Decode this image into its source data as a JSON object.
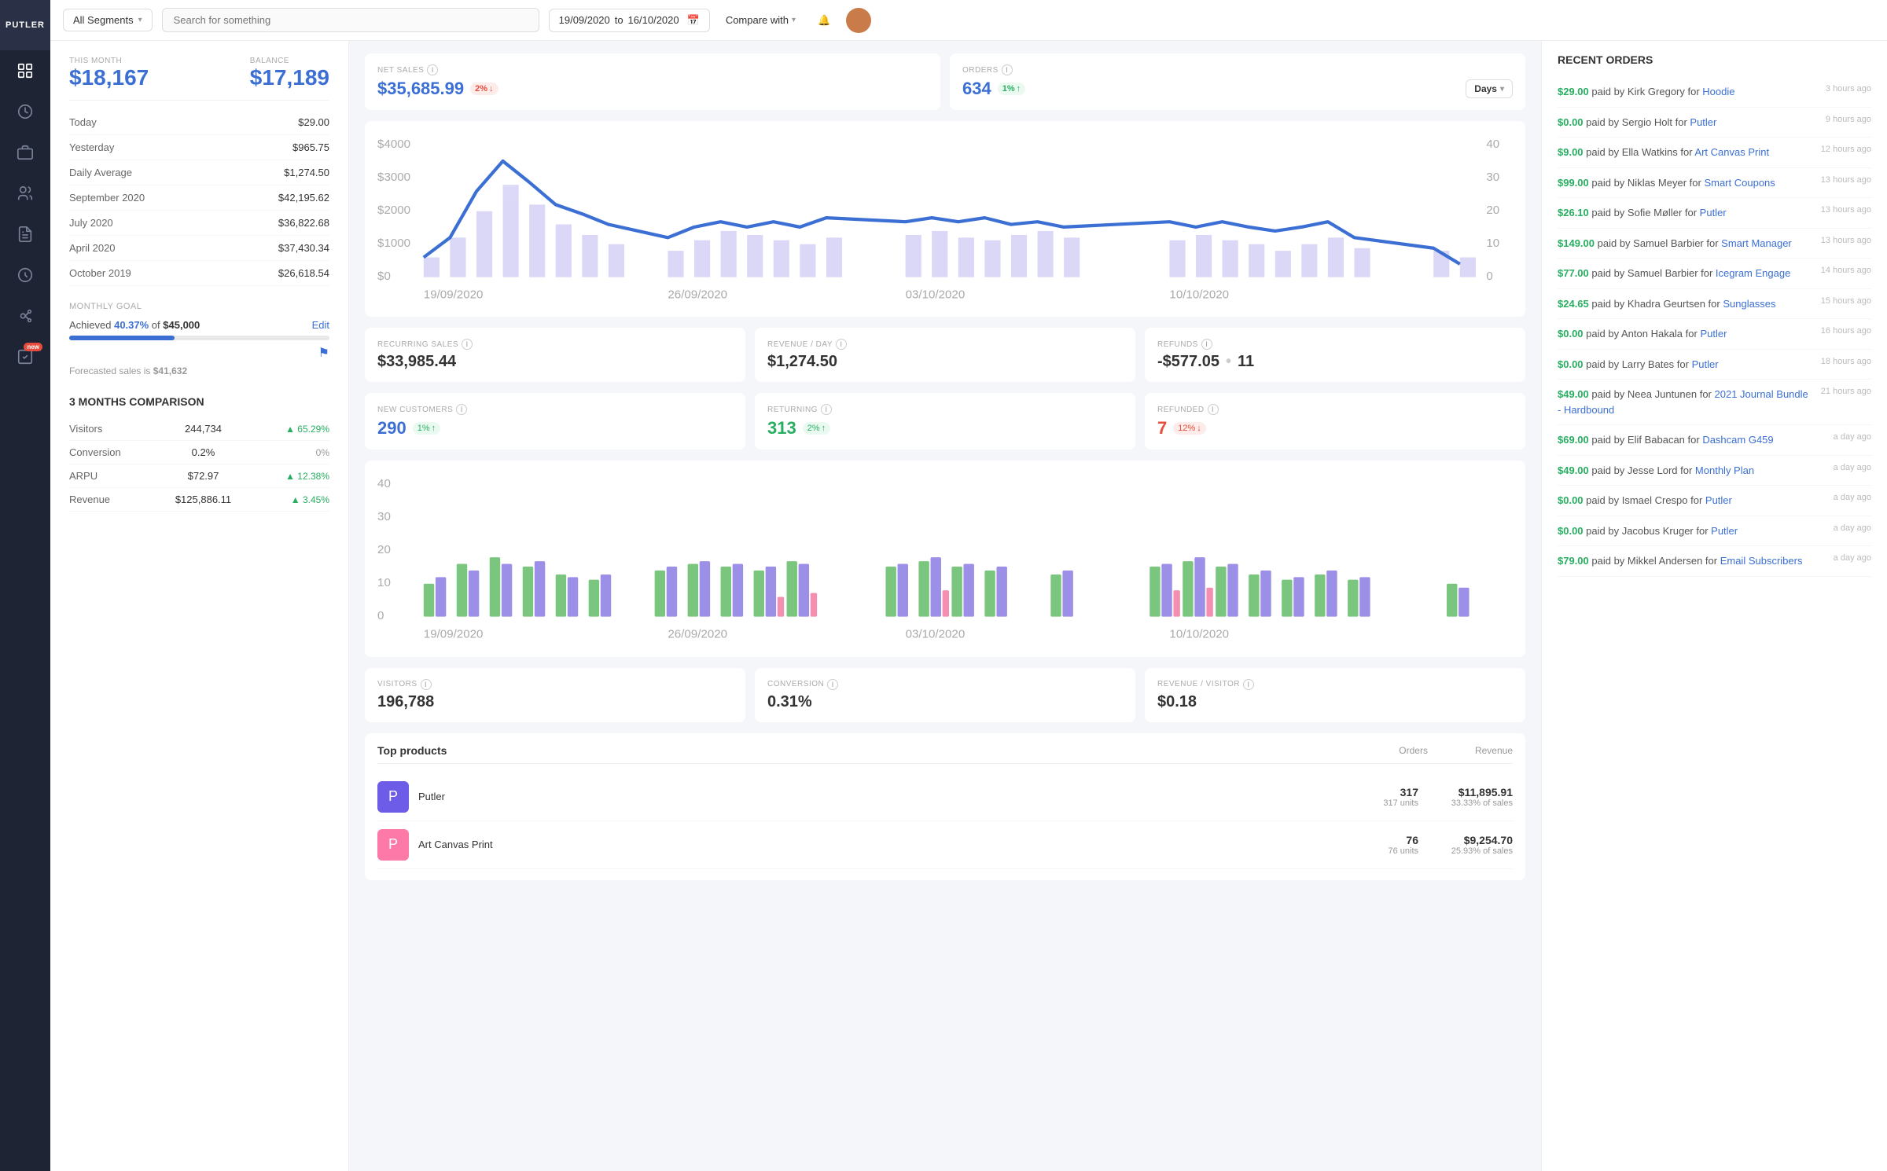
{
  "app": {
    "name": "PUTLER"
  },
  "topbar": {
    "segment_label": "All Segments",
    "search_placeholder": "Search for something",
    "date_from": "19/09/2020",
    "date_to": "16/10/2020",
    "compare_label": "Compare with"
  },
  "left": {
    "this_month_label": "THIS MONTH",
    "balance_label": "BALANCE",
    "this_month_value": "$18,167",
    "balance_value": "$17,189",
    "rows": [
      {
        "label": "Today",
        "value": "$29.00"
      },
      {
        "label": "Yesterday",
        "value": "$965.75"
      },
      {
        "label": "Daily Average",
        "value": "$1,274.50"
      },
      {
        "label": "September 2020",
        "value": "$42,195.62"
      },
      {
        "label": "July 2020",
        "value": "$36,822.68"
      },
      {
        "label": "April 2020",
        "value": "$37,430.34"
      },
      {
        "label": "October 2019",
        "value": "$26,618.54"
      }
    ],
    "goal": {
      "title": "MONTHLY GOAL",
      "achieved_pct": "40.37%",
      "of_amount": "$45,000",
      "edit_label": "Edit",
      "forecast_label": "Forecasted sales is",
      "forecast_value": "$41,632"
    },
    "comparison": {
      "title": "3 MONTHS COMPARISON",
      "rows": [
        {
          "label": "Visitors",
          "value": "244,734",
          "change": "65.29%",
          "dir": "up"
        },
        {
          "label": "Conversion",
          "value": "0.2%",
          "change": "0%",
          "dir": "neutral"
        },
        {
          "label": "ARPU",
          "value": "$72.97",
          "change": "12.38%",
          "dir": "up"
        },
        {
          "label": "Revenue",
          "value": "$125,886.11",
          "change": "3.45%",
          "dir": "up"
        }
      ]
    }
  },
  "middle": {
    "net_sales": {
      "label": "NET SALES",
      "value": "$35,685.99",
      "badge": "2%",
      "badge_dir": "down"
    },
    "orders": {
      "label": "ORDERS",
      "value": "634",
      "badge": "1%",
      "badge_dir": "up"
    },
    "days_btn": "Days",
    "chart_dates": [
      "19/09/2020",
      "26/09/2020",
      "03/10/2020",
      "10/10/2020"
    ],
    "chart_y_labels": [
      "$4000",
      "$3000",
      "$2000",
      "$1000",
      "$0"
    ],
    "chart_y_right": [
      "40",
      "30",
      "20",
      "10",
      "0"
    ],
    "recurring_sales": {
      "label": "RECURRING SALES",
      "value": "$33,985.44"
    },
    "revenue_day": {
      "label": "REVENUE / DAY",
      "value": "$1,274.50"
    },
    "refunds": {
      "label": "REFUNDS",
      "value": "-$577.05",
      "count": "11"
    },
    "new_customers": {
      "label": "NEW CUSTOMERS",
      "value": "290",
      "badge": "1%",
      "badge_dir": "up"
    },
    "returning": {
      "label": "RETURNING",
      "value": "313",
      "badge": "2%",
      "badge_dir": "up"
    },
    "refunded": {
      "label": "REFUNDED",
      "value": "7",
      "badge": "12%",
      "badge_dir": "down"
    },
    "visitors": {
      "label": "VISITORS",
      "value": "196,788"
    },
    "conversion": {
      "label": "CONVERSION",
      "value": "0.31%"
    },
    "revenue_visitor": {
      "label": "REVENUE / VISITOR",
      "value": "$0.18"
    },
    "top_products": {
      "title": "Top products",
      "col_orders": "Orders",
      "col_revenue": "Revenue",
      "items": [
        {
          "name": "Putler",
          "color": "#6c5ce7",
          "orders": "317",
          "units": "317 units",
          "revenue": "$11,895.91",
          "pct_sales": "33.33% of sales"
        },
        {
          "name": "Art Canvas Print",
          "color": "#fd79a8",
          "orders": "76",
          "units": "76 units",
          "revenue": "$9,254.70",
          "pct_sales": "25.93% of sales"
        }
      ]
    }
  },
  "right": {
    "title": "RECENT ORDERS",
    "orders": [
      {
        "amount": "$29.00",
        "payer": "Kirk Gregory",
        "product": "Hoodie",
        "time": "3 hours ago"
      },
      {
        "amount": "$0.00",
        "payer": "Sergio Holt",
        "product": "Putler",
        "time": "9 hours ago"
      },
      {
        "amount": "$9.00",
        "payer": "Ella Watkins",
        "product": "Art Canvas Print",
        "time": "12 hours ago"
      },
      {
        "amount": "$99.00",
        "payer": "Niklas Meyer",
        "product": "Smart Coupons",
        "time": "13 hours ago"
      },
      {
        "amount": "$26.10",
        "payer": "Sofie Møller",
        "product": "Putler",
        "time": "13 hours ago"
      },
      {
        "amount": "$149.00",
        "payer": "Samuel Barbier",
        "product": "Smart Manager",
        "time": "13 hours ago"
      },
      {
        "amount": "$77.00",
        "payer": "Samuel Barbier",
        "product": "Icegram Engage",
        "time": "14 hours ago"
      },
      {
        "amount": "$24.65",
        "payer": "Khadra Geurtsen",
        "product": "Sunglasses",
        "time": "15 hours ago"
      },
      {
        "amount": "$0.00",
        "payer": "Anton Hakala",
        "product": "Putler",
        "time": "16 hours ago"
      },
      {
        "amount": "$0.00",
        "payer": "Larry Bates",
        "product": "Putler",
        "time": "18 hours ago"
      },
      {
        "amount": "$49.00",
        "payer": "Neea Juntunen",
        "product": "2021 Journal Bundle - Hardbound",
        "time": "21 hours ago"
      },
      {
        "amount": "$69.00",
        "payer": "Elif Babacan",
        "product": "Dashcam G459",
        "time": "a day ago"
      },
      {
        "amount": "$49.00",
        "payer": "Jesse Lord",
        "product": "Monthly Plan",
        "time": "a day ago"
      },
      {
        "amount": "$0.00",
        "payer": "Ismael Crespo",
        "product": "Putler",
        "time": "a day ago"
      },
      {
        "amount": "$0.00",
        "payer": "Jacobus Kruger",
        "product": "Putler",
        "time": "a day ago"
      },
      {
        "amount": "$79.00",
        "payer": "Mikkel Andersen",
        "product": "Email Subscribers",
        "time": "a day ago"
      }
    ]
  }
}
